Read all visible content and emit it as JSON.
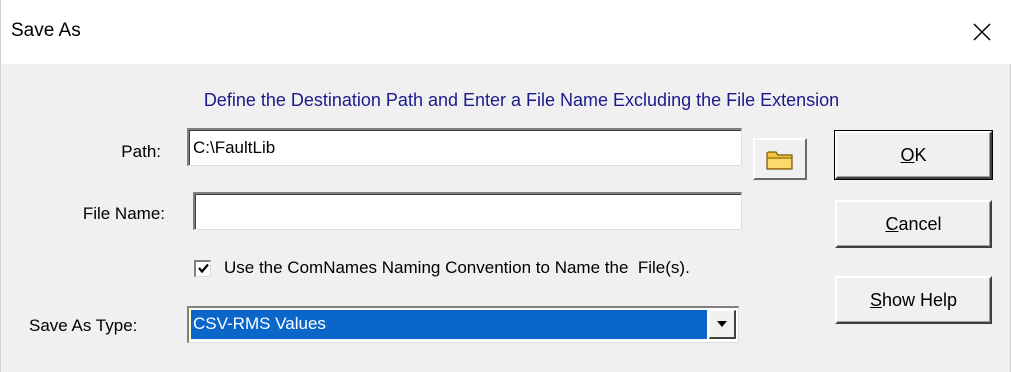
{
  "window": {
    "title": "Save As"
  },
  "instruction": "Define the Destination Path and Enter a File Name Excluding the File Extension",
  "path": {
    "label": "Path:",
    "value": "C:\\FaultLib"
  },
  "file_name": {
    "label": "File Name:",
    "value": ""
  },
  "checkbox": {
    "checked": true,
    "label": "Use the ComNames Naming Convention to Name the  File(s)."
  },
  "save_as_type": {
    "label": "Save As Type:",
    "selected": "CSV-RMS Values"
  },
  "buttons": {
    "ok_mnemonic": "O",
    "ok_rest": "K",
    "cancel_mnemonic": "C",
    "cancel_rest": "ancel",
    "help_mnemonic": "S",
    "help_rest": "how Help"
  },
  "icons": {
    "close": "close-icon",
    "folder": "folder-icon",
    "dropdown": "chevron-down-icon",
    "check": "check-icon"
  }
}
